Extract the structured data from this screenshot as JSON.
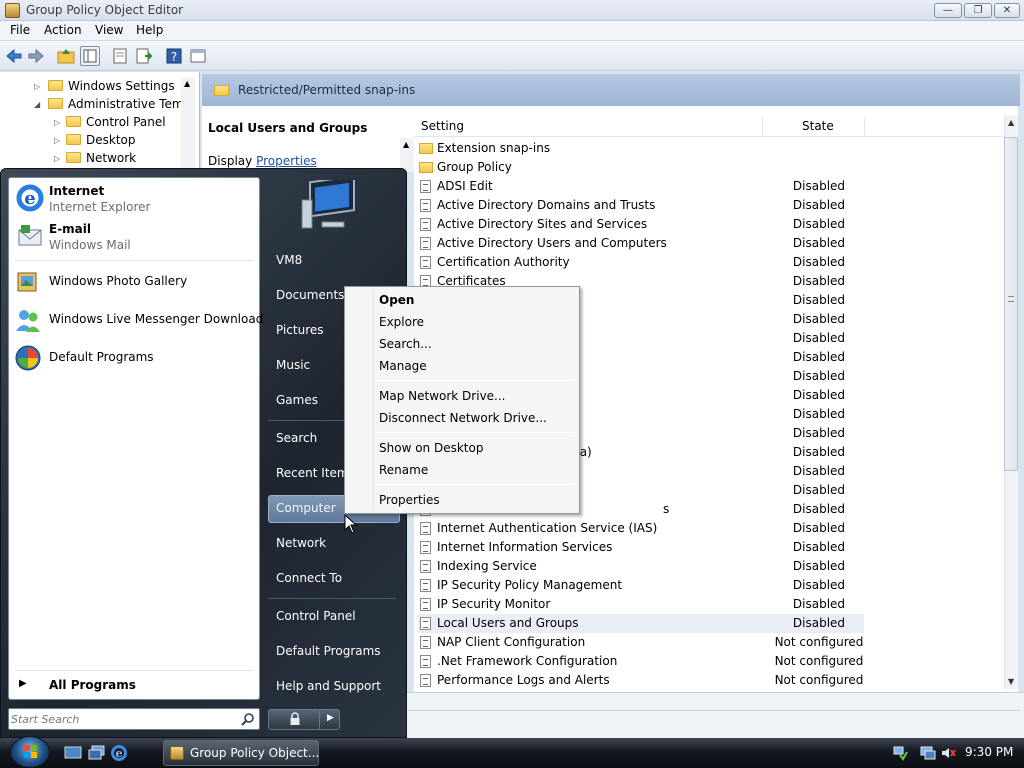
{
  "window": {
    "title": "Group Policy Object Editor",
    "minimize_glyph": "—",
    "maximize_glyph": "❐",
    "close_glyph": "✕"
  },
  "menubar": [
    "File",
    "Action",
    "View",
    "Help"
  ],
  "tree": {
    "nodes": [
      {
        "label": "Windows Settings"
      },
      {
        "label": "Administrative Temp"
      },
      {
        "label": "Control Panel"
      },
      {
        "label": "Desktop"
      },
      {
        "label": "Network"
      }
    ]
  },
  "panel": {
    "header": "Restricted/Permitted snap-ins",
    "description_title": "Local Users and Groups",
    "display_prefix": "Display",
    "display_link": "Properties"
  },
  "list": {
    "columns": [
      "Setting",
      "State"
    ],
    "rows": [
      {
        "name": "Extension snap-ins",
        "state": "",
        "type": "folder"
      },
      {
        "name": "Group Policy",
        "state": "",
        "type": "folder"
      },
      {
        "name": "ADSI Edit",
        "state": "Disabled",
        "type": "setting"
      },
      {
        "name": "Active Directory Domains and Trusts",
        "state": "Disabled",
        "type": "setting"
      },
      {
        "name": "Active Directory Sites and Services",
        "state": "Disabled",
        "type": "setting"
      },
      {
        "name": "Active Directory Users and Computers",
        "state": "Disabled",
        "type": "setting"
      },
      {
        "name": "Certification Authority",
        "state": "Disabled",
        "type": "setting"
      },
      {
        "name": "Certificates",
        "state": "Disabled",
        "type": "setting"
      },
      {
        "name": "",
        "state": "Disabled",
        "type": "setting"
      },
      {
        "name": "",
        "state": "Disabled",
        "type": "setting"
      },
      {
        "name": "",
        "state": "Disabled",
        "type": "setting"
      },
      {
        "name": "",
        "state": "Disabled",
        "type": "setting"
      },
      {
        "name": "",
        "state": "Disabled",
        "type": "setting"
      },
      {
        "name": "",
        "state": "Disabled",
        "type": "setting"
      },
      {
        "name": "",
        "state": "Disabled",
        "type": "setting"
      },
      {
        "name": "",
        "state": "Disabled",
        "type": "setting"
      },
      {
        "name": "",
        "state": "Disabled",
        "type": "setting"
      },
      {
        "name": "",
        "state": "Disabled",
        "type": "setting"
      },
      {
        "name": "",
        "state": "Disabled",
        "type": "setting"
      },
      {
        "name": "",
        "state": "Disabled",
        "type": "setting"
      },
      {
        "name": "Internet Authentication Service (IAS)",
        "state": "Disabled",
        "type": "setting"
      },
      {
        "name": "Internet Information Services",
        "state": "Disabled",
        "type": "setting"
      },
      {
        "name": "Indexing Service",
        "state": "Disabled",
        "type": "setting"
      },
      {
        "name": "IP Security Policy Management",
        "state": "Disabled",
        "type": "setting"
      },
      {
        "name": "IP Security Monitor",
        "state": "Disabled",
        "type": "setting"
      },
      {
        "name": "Local Users and Groups",
        "state": "Disabled",
        "type": "setting"
      },
      {
        "name": "NAP Client Configuration",
        "state": "Not configured",
        "type": "setting"
      },
      {
        "name": ".Net Framework Configuration",
        "state": "Not configured",
        "type": "setting"
      },
      {
        "name": "Performance Logs and Alerts",
        "state": "Not configured",
        "type": "setting"
      }
    ],
    "partial_fragments": [
      "ta)",
      "s"
    ]
  },
  "start_menu": {
    "pinned": [
      {
        "title": "Internet",
        "subtitle": "Internet Explorer",
        "icon": "internet-explorer-icon"
      },
      {
        "title": "E-mail",
        "subtitle": "Windows Mail",
        "icon": "windows-mail-icon"
      }
    ],
    "recent": [
      {
        "title": "Windows Photo Gallery",
        "icon": "photo-gallery-icon"
      },
      {
        "title": "Windows Live Messenger Download",
        "icon": "messenger-icon"
      },
      {
        "title": "Default Programs",
        "icon": "default-programs-icon"
      }
    ],
    "all_programs": "All Programs",
    "search_placeholder": "Start Search",
    "right_links": [
      "VM8",
      "Documents",
      "Pictures",
      "Music",
      "Games",
      "Search",
      "Recent Items",
      "Computer",
      "Network",
      "Connect To",
      "Control Panel",
      "Default Programs",
      "Help and Support"
    ]
  },
  "context_menu": {
    "items": [
      {
        "label": "Open",
        "bold": true
      },
      {
        "label": "Explore"
      },
      {
        "label": "Search..."
      },
      {
        "label": "Manage"
      },
      {
        "label": "Map Network Drive..."
      },
      {
        "label": "Disconnect Network Drive..."
      },
      {
        "label": "Show on Desktop"
      },
      {
        "label": "Rename"
      },
      {
        "label": "Properties"
      }
    ]
  },
  "taskbar": {
    "task_label": "Group Policy Object...",
    "clock": "9:30 PM"
  },
  "colors": {
    "title_bar": "#d6dfeb",
    "panel_band": "#9fb4d6",
    "start_menu_dark": "#1d2530",
    "highlight": "#5f7a9b",
    "link": "#1a53a7"
  }
}
